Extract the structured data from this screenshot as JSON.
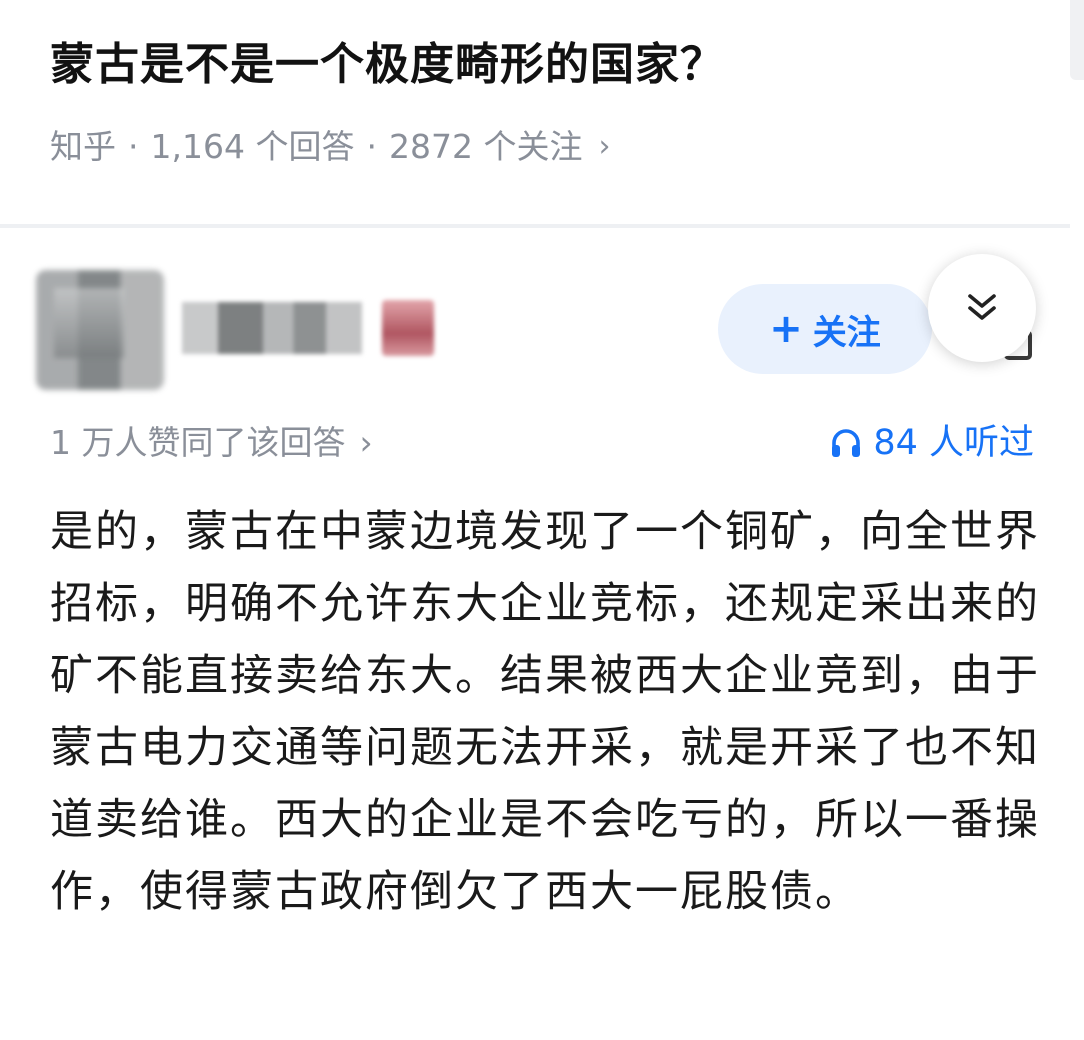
{
  "question": {
    "title": "蒙古是不是一个极度畸形的国家？",
    "source": "知乎",
    "separator": "·",
    "answers": "1,164 个回答",
    "followers": "2872 个关注",
    "chevron": "›"
  },
  "answer": {
    "follow_label": "关注",
    "follow_icon": "plus-icon",
    "expand_icon": "double-chevron-down-icon",
    "agree_text": "1 万人赞同了该回答",
    "agree_chevron": "›",
    "listen_icon": "headphones-icon",
    "listen_text": "84 人听过",
    "body": "是的，蒙古在中蒙边境发现了一个铜矿，向全世界招标，明确不允许东大企业竞标，还规定采出来的矿不能直接卖给东大。结果被西大企业竞到，由于蒙古电力交通等问题无法开采，就是开采了也不知道卖给谁。西大的企业是不会吃亏的，所以一番操作，使得蒙古政府倒欠了西大一屁股债。"
  },
  "colors": {
    "accent": "#1772f6",
    "meta_gray": "#8a8f99",
    "follow_bg": "#e9f1fd"
  }
}
